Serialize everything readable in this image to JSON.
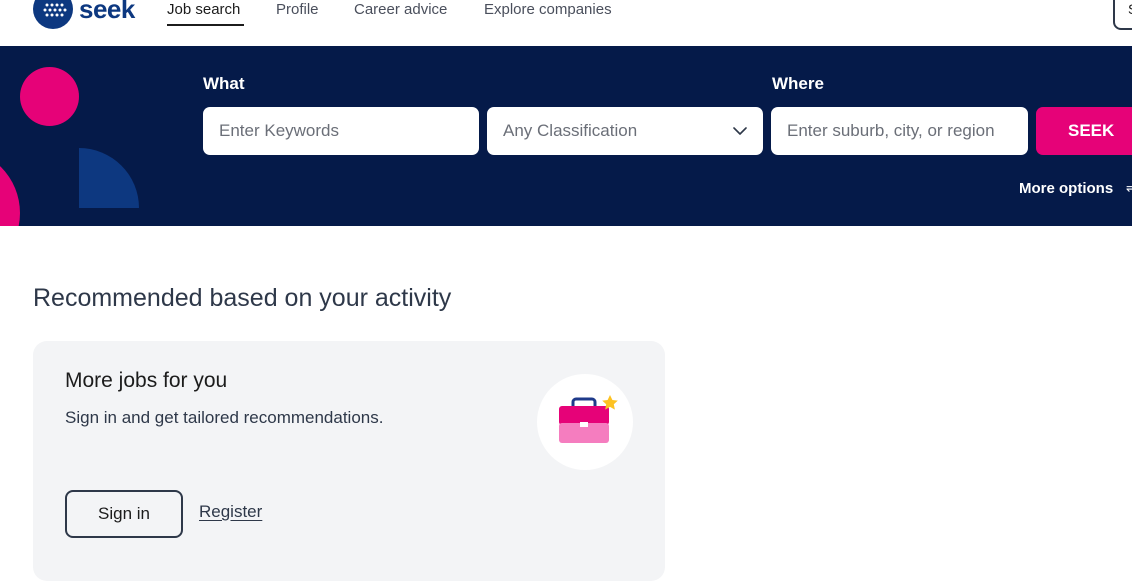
{
  "brand": {
    "name": "seek",
    "logo_icon": "seek-logo-icon"
  },
  "nav": {
    "links": [
      "Job search",
      "Profile",
      "Career advice",
      "Explore companies"
    ],
    "active": "Job search",
    "edge_button_label": "S"
  },
  "search": {
    "what_label": "What",
    "where_label": "Where",
    "keywords_placeholder": "Enter Keywords",
    "classification_value": "Any Classification",
    "location_placeholder": "Enter suburb, city, or region",
    "seek_button": "SEEK",
    "more_options": "More options",
    "more_options_icon": "filter-icon"
  },
  "recommended": {
    "title": "Recommended based on your activity",
    "card": {
      "title": "More jobs for you",
      "text": "Sign in and get tailored recommendations.",
      "sign_in": "Sign in",
      "register": "Register",
      "illustration": "briefcase-star-icon"
    }
  },
  "colors": {
    "hero_bg": "#051a49",
    "brand_pink": "#e60278",
    "brand_blue": "#0d3880",
    "card_bg": "#f3f4f6"
  }
}
